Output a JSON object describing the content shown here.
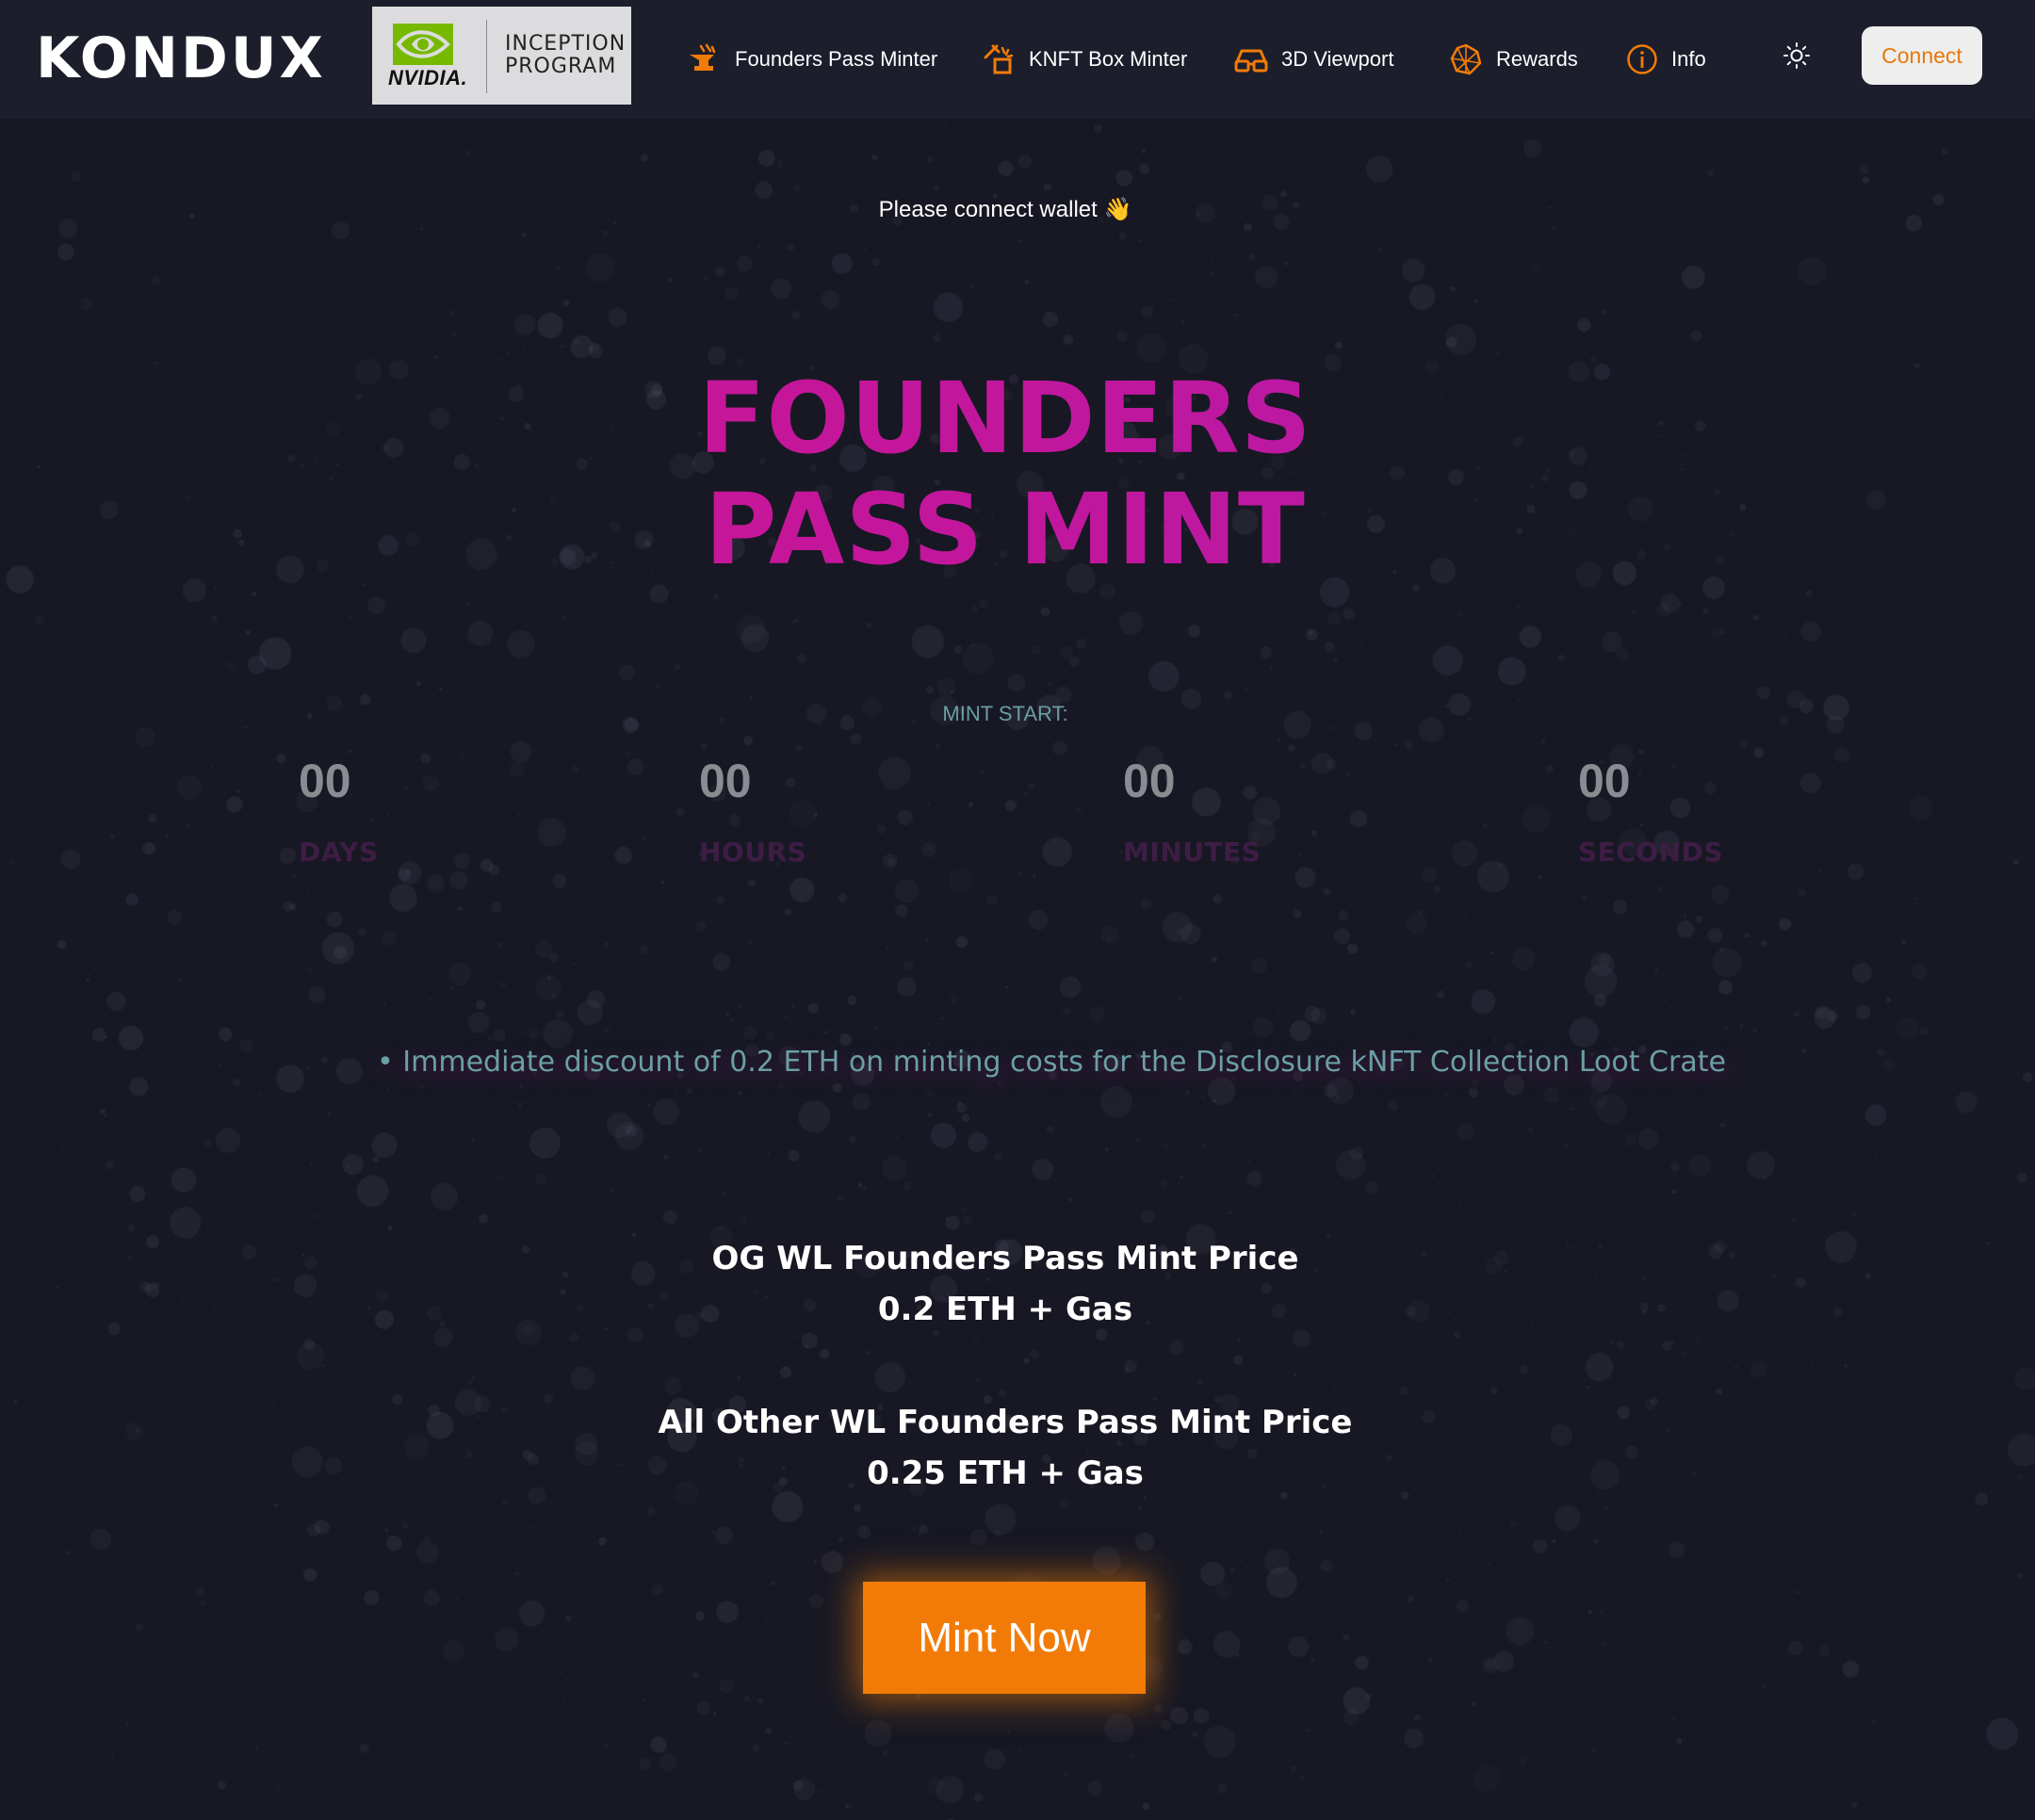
{
  "brand": {
    "logo_text": "KONDUX",
    "partner_word": "NVIDIA.",
    "partner_program_line1": "INCEPTION",
    "partner_program_line2": "PROGRAM"
  },
  "nav": {
    "items": [
      {
        "label": "Founders Pass Minter",
        "icon": "founders-pass-icon"
      },
      {
        "label": "KNFT Box Minter",
        "icon": "knft-box-icon"
      },
      {
        "label": "3D Viewport",
        "icon": "3d-glasses-icon"
      },
      {
        "label": "Rewards",
        "icon": "rewards-icon"
      },
      {
        "label": "Info",
        "icon": "info-icon"
      }
    ],
    "theme_icon": "sun-icon",
    "connect_label": "Connect"
  },
  "main": {
    "connect_message": "Please connect wallet 👋",
    "hero_line1": "FOUNDERS",
    "hero_line2": "PASS MINT",
    "mint_start_label": "MINT START:",
    "countdown": [
      {
        "value": "00",
        "label": "DAYS"
      },
      {
        "value": "00",
        "label": "HOURS"
      },
      {
        "value": "00",
        "label": "MINUTES"
      },
      {
        "value": "00",
        "label": "SECONDS"
      }
    ],
    "discount_text": "• Immediate discount of 0.2 ETH on minting costs for the Disclosure kNFT Collection Loot Crate",
    "og_price_title": "OG WL Founders Pass Mint Price",
    "og_price_value": "0.2 ETH + Gas",
    "other_price_title": "All Other WL Founders Pass Mint Price",
    "other_price_value": "0.25 ETH + Gas",
    "mint_button_label": "Mint Now"
  },
  "colors": {
    "background": "#171823",
    "navbar": "#1c1e2c",
    "accent_orange": "#f27b07",
    "hero_magenta": "#d21491",
    "muted_teal": "#6a9ea3",
    "countdown_label": "#3e1d45"
  }
}
